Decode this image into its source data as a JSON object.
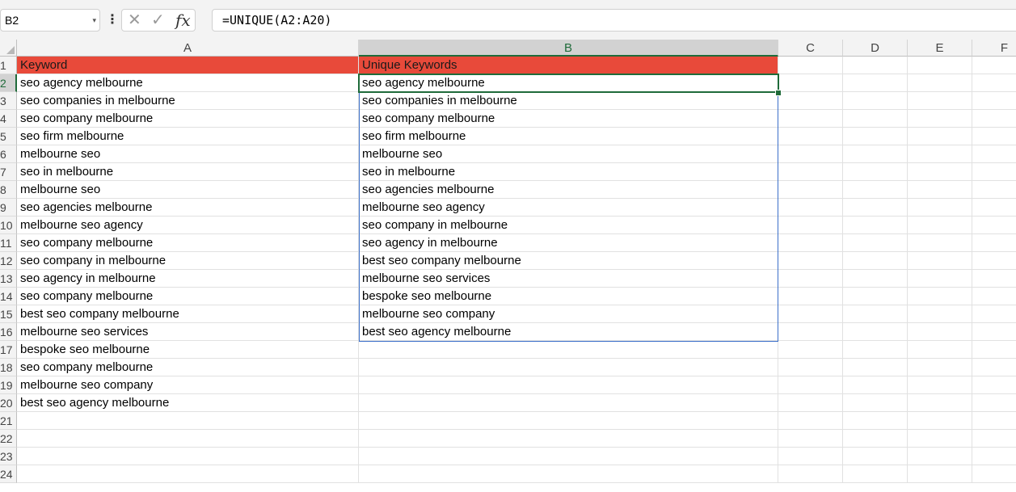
{
  "name_box": "B2",
  "formula": "=UNIQUE(A2:A20)",
  "icons": {
    "cancel": "x-icon",
    "enter": "check-icon",
    "function": "fx-icon"
  },
  "colors": {
    "header_fill": "#e84a3a",
    "selection": "#1f6b3a",
    "spill_border": "#3b6fc9"
  },
  "columns": [
    "A",
    "B",
    "C",
    "D",
    "E",
    "F"
  ],
  "selected_column": "B",
  "rows": [
    "1",
    "2",
    "3",
    "4",
    "5",
    "6",
    "7",
    "8",
    "9",
    "10",
    "11",
    "12",
    "13",
    "14",
    "15",
    "16",
    "17",
    "18",
    "19",
    "20",
    "21",
    "22",
    "23",
    "24"
  ],
  "selected_row": "2",
  "column_a": [
    "Keyword",
    "seo agency melbourne",
    "seo companies in melbourne",
    "seo company melbourne",
    "seo firm melbourne",
    "melbourne seo",
    "seo in melbourne",
    "melbourne seo",
    "seo agencies melbourne",
    "melbourne seo agency",
    "seo company melbourne",
    "seo company in melbourne",
    "seo agency in melbourne",
    "seo company melbourne",
    "best seo company melbourne",
    "melbourne seo services",
    "bespoke seo melbourne",
    "seo company melbourne",
    "melbourne seo company",
    "best seo agency melbourne"
  ],
  "column_b": [
    "Unique Keywords",
    "seo agency melbourne",
    "seo companies in melbourne",
    "seo company melbourne",
    "seo firm melbourne",
    "melbourne seo",
    "seo in melbourne",
    "seo agencies melbourne",
    "melbourne seo agency",
    "seo company in melbourne",
    "seo agency in melbourne",
    "best seo company melbourne",
    "melbourne seo services",
    "bespoke seo melbourne",
    "melbourne seo company",
    "best seo agency melbourne"
  ]
}
